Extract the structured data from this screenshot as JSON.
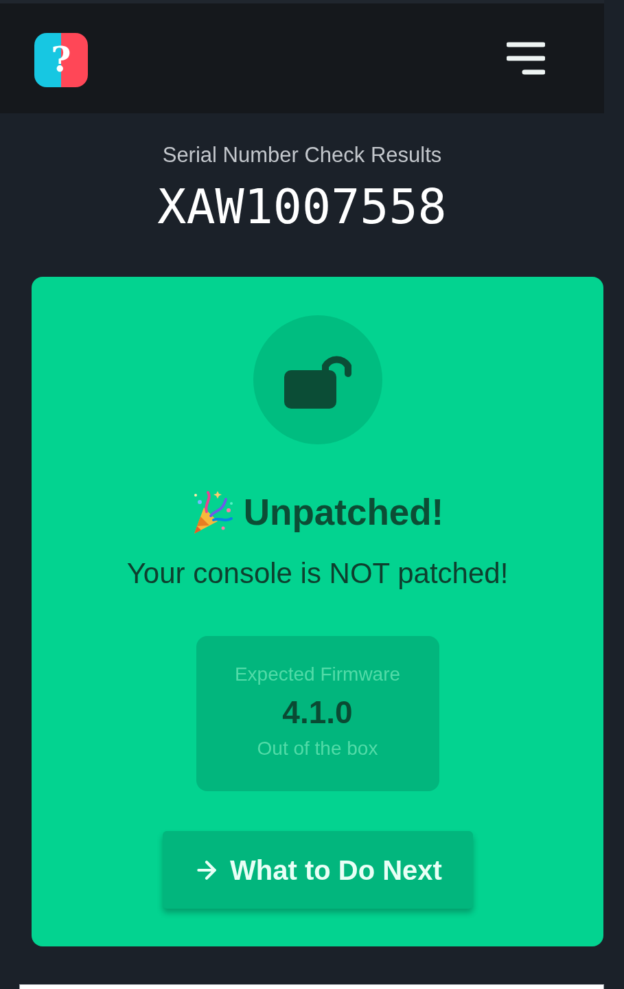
{
  "header": {
    "logo_mark": "?"
  },
  "results": {
    "heading": "Serial Number Check Results",
    "serial": "XAW1007558"
  },
  "status_card": {
    "kind": "unpatched",
    "title": "Unpatched!",
    "message": "Your console is NOT patched!",
    "firmware": {
      "label": "Expected Firmware",
      "version": "4.1.0",
      "note": "Out of the box"
    },
    "action": "What to Do Next"
  }
}
